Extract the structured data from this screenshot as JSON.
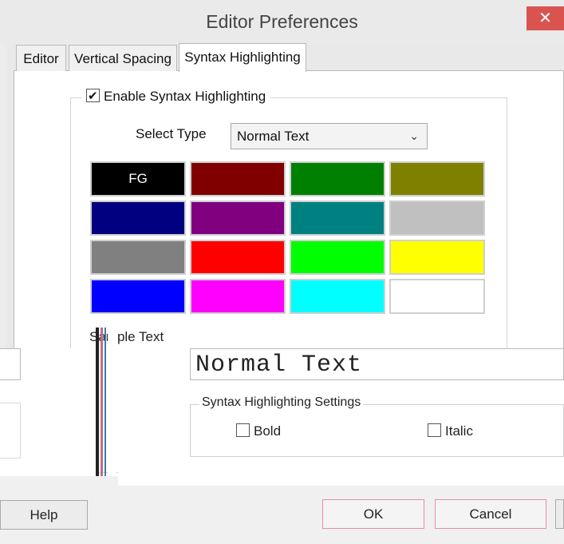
{
  "window": {
    "title": "Editor Preferences",
    "close_glyph": "✕"
  },
  "tabs": [
    {
      "label": "Editor",
      "active": false
    },
    {
      "label": "Vertical Spacing",
      "active": false
    },
    {
      "label": "Syntax Highlighting",
      "active": true
    }
  ],
  "enable": {
    "label": "Enable Syntax Highlighting",
    "checked": true
  },
  "select_type": {
    "label": "Select Type",
    "value": "Normal Text"
  },
  "colors": [
    {
      "hex": "#000000",
      "label": "FG"
    },
    {
      "hex": "#800000",
      "label": ""
    },
    {
      "hex": "#008000",
      "label": ""
    },
    {
      "hex": "#808000",
      "label": ""
    },
    {
      "hex": "#000080",
      "label": ""
    },
    {
      "hex": "#800080",
      "label": ""
    },
    {
      "hex": "#008080",
      "label": ""
    },
    {
      "hex": "#c0c0c0",
      "label": ""
    },
    {
      "hex": "#808080",
      "label": ""
    },
    {
      "hex": "#ff0000",
      "label": ""
    },
    {
      "hex": "#00ff00",
      "label": ""
    },
    {
      "hex": "#ffff00",
      "label": ""
    },
    {
      "hex": "#0000ff",
      "label": ""
    },
    {
      "hex": "#ff00ff",
      "label": ""
    },
    {
      "hex": "#00ffff",
      "label": ""
    },
    {
      "hex": "#ffffff",
      "label": ""
    }
  ],
  "sample": {
    "label": "Sample Text",
    "text": "Normal Text"
  },
  "settings": {
    "label": "Syntax Highlighting Settings",
    "bold": "Bold",
    "italic": "Italic"
  },
  "buttons": {
    "help": "Help",
    "ok": "OK",
    "cancel": "Cancel"
  }
}
